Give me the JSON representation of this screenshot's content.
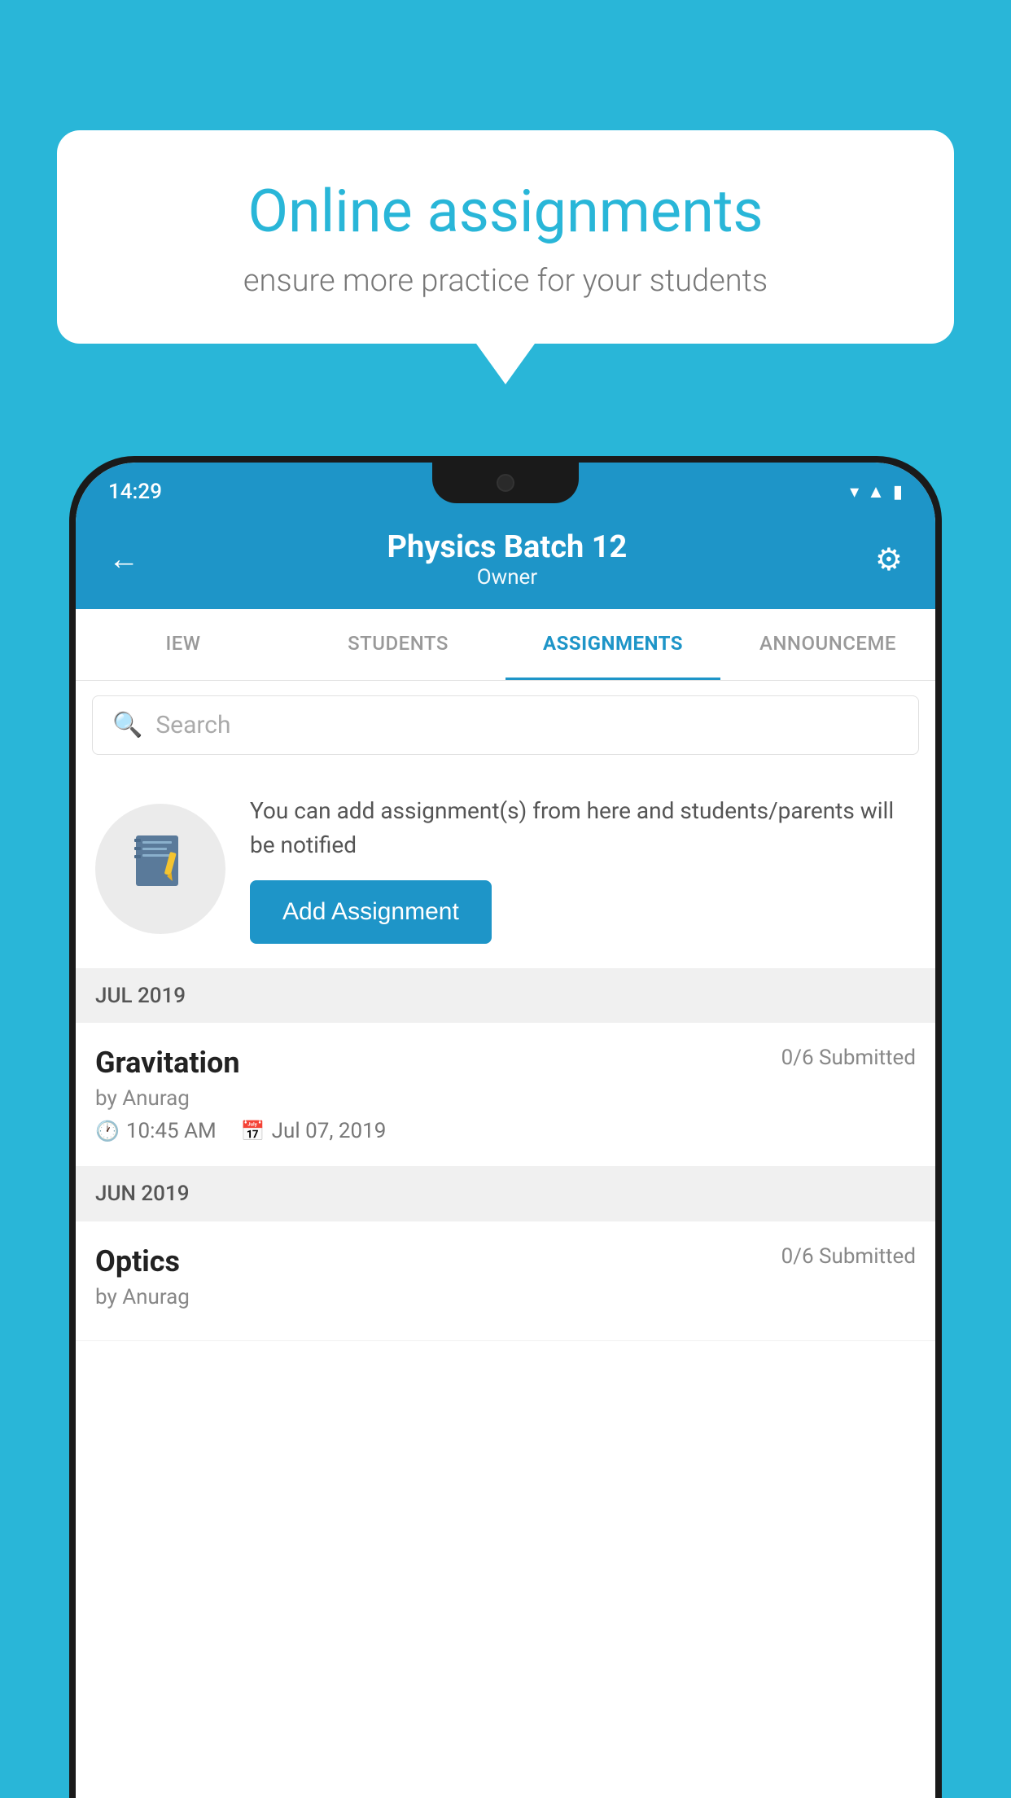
{
  "background_color": "#29b6d8",
  "speech_bubble": {
    "title": "Online assignments",
    "subtitle": "ensure more practice for your students"
  },
  "status_bar": {
    "time": "14:29",
    "wifi": "▾",
    "signal": "◂",
    "battery": "▮"
  },
  "header": {
    "title": "Physics Batch 12",
    "subtitle": "Owner",
    "back_label": "←",
    "settings_label": "⚙"
  },
  "tabs": [
    {
      "label": "IEW",
      "active": false
    },
    {
      "label": "STUDENTS",
      "active": false
    },
    {
      "label": "ASSIGNMENTS",
      "active": true
    },
    {
      "label": "ANNOUNCEMENTS",
      "active": false
    }
  ],
  "search": {
    "placeholder": "Search"
  },
  "promo": {
    "description": "You can add assignment(s) from here and students/parents will be notified",
    "button_label": "Add Assignment"
  },
  "sections": [
    {
      "month": "JUL 2019",
      "assignments": [
        {
          "title": "Gravitation",
          "submitted": "0/6 Submitted",
          "author": "by Anurag",
          "time": "10:45 AM",
          "date": "Jul 07, 2019"
        }
      ]
    },
    {
      "month": "JUN 2019",
      "assignments": [
        {
          "title": "Optics",
          "submitted": "0/6 Submitted",
          "author": "by Anurag",
          "time": "",
          "date": ""
        }
      ]
    }
  ]
}
